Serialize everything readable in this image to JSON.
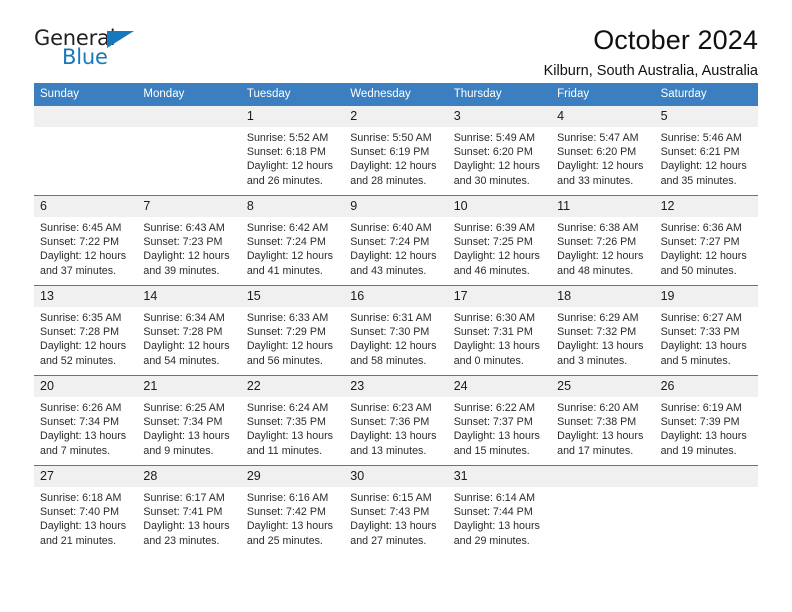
{
  "brand": {
    "name_top": "General",
    "name_bottom": "Blue",
    "accent_color": "#1878be"
  },
  "header": {
    "title": "October 2024",
    "location": "Kilburn, South Australia, Australia"
  },
  "calendar": {
    "header_bg": "#3b7fc0",
    "daynum_bg": "#f0f0f0",
    "weekdays": [
      "Sunday",
      "Monday",
      "Tuesday",
      "Wednesday",
      "Thursday",
      "Friday",
      "Saturday"
    ],
    "weeks": [
      [
        {
          "num": "",
          "lines": []
        },
        {
          "num": "",
          "lines": []
        },
        {
          "num": "1",
          "lines": [
            "Sunrise: 5:52 AM",
            "Sunset: 6:18 PM",
            "Daylight: 12 hours",
            "and 26 minutes."
          ]
        },
        {
          "num": "2",
          "lines": [
            "Sunrise: 5:50 AM",
            "Sunset: 6:19 PM",
            "Daylight: 12 hours",
            "and 28 minutes."
          ]
        },
        {
          "num": "3",
          "lines": [
            "Sunrise: 5:49 AM",
            "Sunset: 6:20 PM",
            "Daylight: 12 hours",
            "and 30 minutes."
          ]
        },
        {
          "num": "4",
          "lines": [
            "Sunrise: 5:47 AM",
            "Sunset: 6:20 PM",
            "Daylight: 12 hours",
            "and 33 minutes."
          ]
        },
        {
          "num": "5",
          "lines": [
            "Sunrise: 5:46 AM",
            "Sunset: 6:21 PM",
            "Daylight: 12 hours",
            "and 35 minutes."
          ]
        }
      ],
      [
        {
          "num": "6",
          "lines": [
            "Sunrise: 6:45 AM",
            "Sunset: 7:22 PM",
            "Daylight: 12 hours",
            "and 37 minutes."
          ]
        },
        {
          "num": "7",
          "lines": [
            "Sunrise: 6:43 AM",
            "Sunset: 7:23 PM",
            "Daylight: 12 hours",
            "and 39 minutes."
          ]
        },
        {
          "num": "8",
          "lines": [
            "Sunrise: 6:42 AM",
            "Sunset: 7:24 PM",
            "Daylight: 12 hours",
            "and 41 minutes."
          ]
        },
        {
          "num": "9",
          "lines": [
            "Sunrise: 6:40 AM",
            "Sunset: 7:24 PM",
            "Daylight: 12 hours",
            "and 43 minutes."
          ]
        },
        {
          "num": "10",
          "lines": [
            "Sunrise: 6:39 AM",
            "Sunset: 7:25 PM",
            "Daylight: 12 hours",
            "and 46 minutes."
          ]
        },
        {
          "num": "11",
          "lines": [
            "Sunrise: 6:38 AM",
            "Sunset: 7:26 PM",
            "Daylight: 12 hours",
            "and 48 minutes."
          ]
        },
        {
          "num": "12",
          "lines": [
            "Sunrise: 6:36 AM",
            "Sunset: 7:27 PM",
            "Daylight: 12 hours",
            "and 50 minutes."
          ]
        }
      ],
      [
        {
          "num": "13",
          "lines": [
            "Sunrise: 6:35 AM",
            "Sunset: 7:28 PM",
            "Daylight: 12 hours",
            "and 52 minutes."
          ]
        },
        {
          "num": "14",
          "lines": [
            "Sunrise: 6:34 AM",
            "Sunset: 7:28 PM",
            "Daylight: 12 hours",
            "and 54 minutes."
          ]
        },
        {
          "num": "15",
          "lines": [
            "Sunrise: 6:33 AM",
            "Sunset: 7:29 PM",
            "Daylight: 12 hours",
            "and 56 minutes."
          ]
        },
        {
          "num": "16",
          "lines": [
            "Sunrise: 6:31 AM",
            "Sunset: 7:30 PM",
            "Daylight: 12 hours",
            "and 58 minutes."
          ]
        },
        {
          "num": "17",
          "lines": [
            "Sunrise: 6:30 AM",
            "Sunset: 7:31 PM",
            "Daylight: 13 hours",
            "and 0 minutes."
          ]
        },
        {
          "num": "18",
          "lines": [
            "Sunrise: 6:29 AM",
            "Sunset: 7:32 PM",
            "Daylight: 13 hours",
            "and 3 minutes."
          ]
        },
        {
          "num": "19",
          "lines": [
            "Sunrise: 6:27 AM",
            "Sunset: 7:33 PM",
            "Daylight: 13 hours",
            "and 5 minutes."
          ]
        }
      ],
      [
        {
          "num": "20",
          "lines": [
            "Sunrise: 6:26 AM",
            "Sunset: 7:34 PM",
            "Daylight: 13 hours",
            "and 7 minutes."
          ]
        },
        {
          "num": "21",
          "lines": [
            "Sunrise: 6:25 AM",
            "Sunset: 7:34 PM",
            "Daylight: 13 hours",
            "and 9 minutes."
          ]
        },
        {
          "num": "22",
          "lines": [
            "Sunrise: 6:24 AM",
            "Sunset: 7:35 PM",
            "Daylight: 13 hours",
            "and 11 minutes."
          ]
        },
        {
          "num": "23",
          "lines": [
            "Sunrise: 6:23 AM",
            "Sunset: 7:36 PM",
            "Daylight: 13 hours",
            "and 13 minutes."
          ]
        },
        {
          "num": "24",
          "lines": [
            "Sunrise: 6:22 AM",
            "Sunset: 7:37 PM",
            "Daylight: 13 hours",
            "and 15 minutes."
          ]
        },
        {
          "num": "25",
          "lines": [
            "Sunrise: 6:20 AM",
            "Sunset: 7:38 PM",
            "Daylight: 13 hours",
            "and 17 minutes."
          ]
        },
        {
          "num": "26",
          "lines": [
            "Sunrise: 6:19 AM",
            "Sunset: 7:39 PM",
            "Daylight: 13 hours",
            "and 19 minutes."
          ]
        }
      ],
      [
        {
          "num": "27",
          "lines": [
            "Sunrise: 6:18 AM",
            "Sunset: 7:40 PM",
            "Daylight: 13 hours",
            "and 21 minutes."
          ]
        },
        {
          "num": "28",
          "lines": [
            "Sunrise: 6:17 AM",
            "Sunset: 7:41 PM",
            "Daylight: 13 hours",
            "and 23 minutes."
          ]
        },
        {
          "num": "29",
          "lines": [
            "Sunrise: 6:16 AM",
            "Sunset: 7:42 PM",
            "Daylight: 13 hours",
            "and 25 minutes."
          ]
        },
        {
          "num": "30",
          "lines": [
            "Sunrise: 6:15 AM",
            "Sunset: 7:43 PM",
            "Daylight: 13 hours",
            "and 27 minutes."
          ]
        },
        {
          "num": "31",
          "lines": [
            "Sunrise: 6:14 AM",
            "Sunset: 7:44 PM",
            "Daylight: 13 hours",
            "and 29 minutes."
          ]
        },
        {
          "num": "",
          "lines": []
        },
        {
          "num": "",
          "lines": []
        }
      ]
    ]
  }
}
